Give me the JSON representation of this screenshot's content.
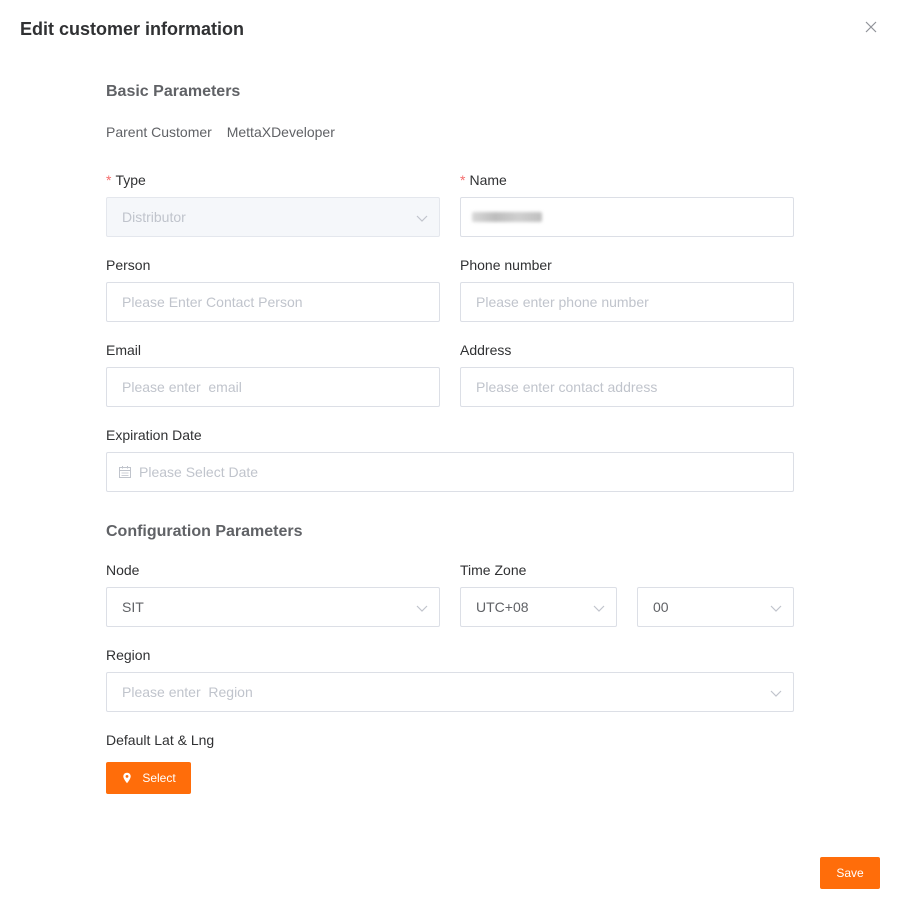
{
  "dialog": {
    "title": "Edit customer information",
    "close_icon": "close-icon",
    "save_label": "Save"
  },
  "basic": {
    "title": "Basic Parameters",
    "parent_label": "Parent Customer",
    "parent_value": "MettaXDeveloper",
    "type": {
      "label": "Type",
      "required": "*",
      "value": "Distributor",
      "disabled": true
    },
    "name": {
      "label": "Name",
      "required": "*",
      "value_redacted": true
    },
    "person": {
      "label": "Person",
      "placeholder": "Please Enter Contact Person"
    },
    "phone": {
      "label": "Phone number",
      "placeholder": "Please enter phone number"
    },
    "email": {
      "label": "Email",
      "placeholder": "Please enter  email"
    },
    "address": {
      "label": "Address",
      "placeholder": "Please enter contact address"
    },
    "expiration": {
      "label": "Expiration Date",
      "placeholder": "Please Select Date"
    }
  },
  "config": {
    "title": "Configuration Parameters",
    "node": {
      "label": "Node",
      "value": "SIT"
    },
    "timezone": {
      "label": "Time Zone",
      "value": "UTC+08",
      "minutes": "00"
    },
    "region": {
      "label": "Region",
      "placeholder": "Please enter  Region"
    },
    "latlng": {
      "label": "Default Lat & Lng",
      "button_label": "Select"
    }
  },
  "colors": {
    "accent": "#ff6d0a",
    "required": "#f56c6c",
    "placeholder": "#c0c4cc",
    "border": "#dcdfe6"
  }
}
